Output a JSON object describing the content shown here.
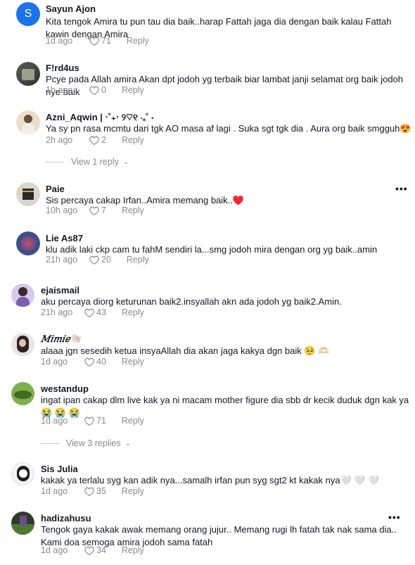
{
  "comments": [
    {
      "username": "Sayun Ajon",
      "avatar_letter": "S",
      "text": "Kita tengok Amira tu pun tau dia baik..harap Fattah jaga dia dengan baik kalau Fattah kawin dengan Amira",
      "time": "1d ago",
      "likes": "71",
      "reply": "Reply"
    },
    {
      "username": "F!rd4us",
      "text": "Pcye pada Allah amira Akan dpt jodoh yg terbaik biar lambat janji selamat org baik jodoh nye baik",
      "time": "1h ago",
      "likes": "0",
      "reply": "Reply"
    },
    {
      "username": "Azni_Aqwin | ⋅˚₊‧ ୨♡୧ ‧₊˚ ⋅",
      "text": "Ya sy pn rasa mcmtu dari tgk AO masa af lagi . Suka sgt tgk dia . Aura org baik smgguh😍",
      "time": "2h ago",
      "likes": "2",
      "reply": "Reply",
      "view_replies": "View 1 reply"
    },
    {
      "username": "Paie",
      "text": "Sis percaya cakap Irfan..Amira memang baik..♥️",
      "time": "10h ago",
      "likes": "7",
      "reply": "Reply"
    },
    {
      "username": "Lie As87",
      "text": "klu adik laki ckp cam tu fahM sendiri la...smg jodoh mira dengan org yg baik..amin",
      "time": "21h ago",
      "likes": "20",
      "reply": "Reply"
    },
    {
      "username": "ejaismail",
      "text": "aku percaya diorg keturunan baik2.insyallah akn ada jodoh yg baik2.Amin.",
      "time": "21h ago",
      "likes": "43",
      "reply": "Reply"
    },
    {
      "username": "𝑀𝑖𝑚𝑖𝑒🐚",
      "text": "alaaa jgn sesedih ketua insyaAllah dia akan jaga kakya dgn baik 🥺 🫶🏻",
      "time": "1d ago",
      "likes": "40",
      "reply": "Reply"
    },
    {
      "username": "westandup",
      "text": "ingat ipan cakap dlm live kak ya ni macam mother figure dia sbb dr kecik duduk dgn kak ya😭 😭 😭",
      "time": "1d ago",
      "likes": "71",
      "reply": "Reply",
      "view_replies": "View 3 replies"
    },
    {
      "username": "Sis Julia",
      "text": "kakak ya terlalu syg kan adik nya...samalh irfan pun syg sgt2 kt kakak nya🤍 🤍 🤍",
      "time": "1d ago",
      "likes": "35",
      "reply": "Reply"
    },
    {
      "username": "hadizahusu",
      "text": "Tengok gaya kakak awak memang orang jujur.. Memang rugi lh fatah tak nak sama dia.. Kami doa semoga amira jodoh sama fatah",
      "time": "1d ago",
      "likes": "34",
      "reply": "Reply"
    }
  ],
  "icons": {
    "like": "heart-outline-icon",
    "more": "more-dots-icon",
    "chevron": "chevron-down-icon"
  },
  "more_label": "•••",
  "chevron_glyph": "⌄",
  "colors": {
    "text": "#161823",
    "meta": "#8a8b91",
    "accent": "#1a73e8"
  }
}
